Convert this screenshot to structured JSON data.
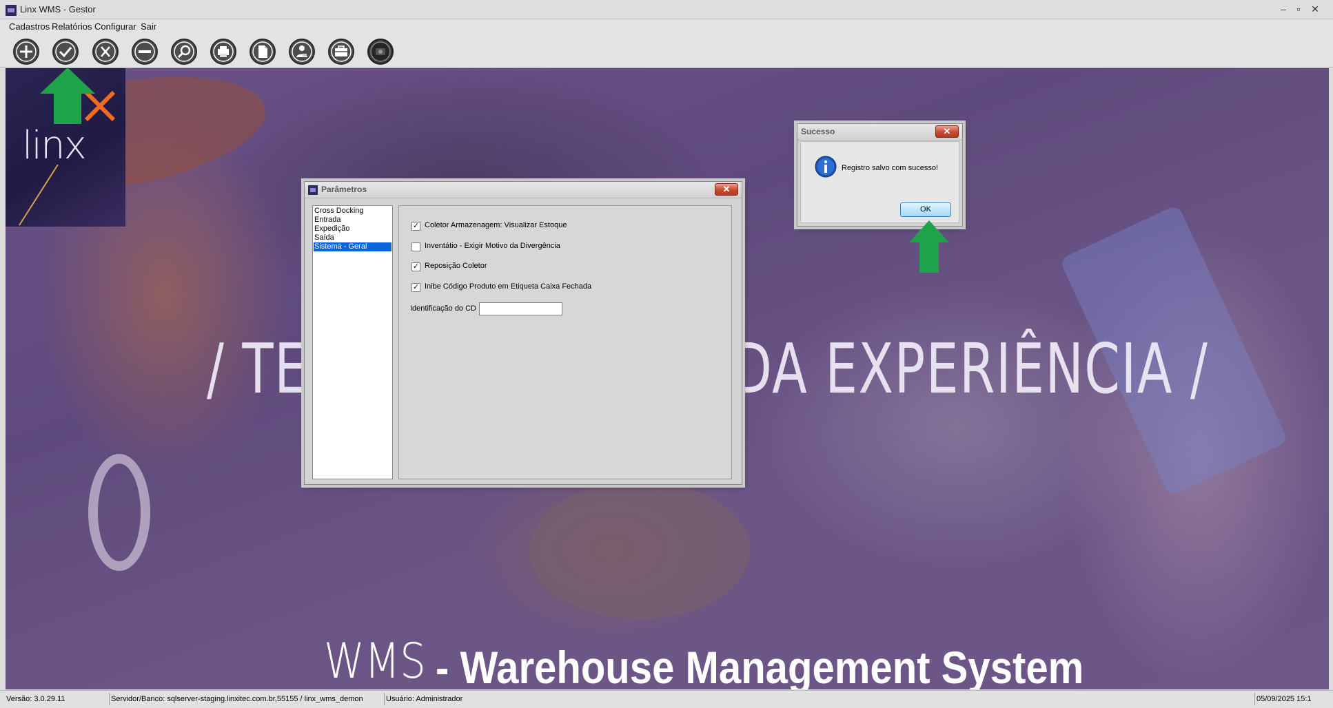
{
  "window": {
    "title": "Linx WMS - Gestor"
  },
  "menu": {
    "items": [
      "Cadastros",
      "Relatórios",
      "Configurar",
      "Sair"
    ]
  },
  "toolbar": {
    "buttons": [
      {
        "icon": "plus-icon"
      },
      {
        "icon": "check-icon"
      },
      {
        "icon": "x-icon"
      },
      {
        "icon": "minus-icon"
      },
      {
        "icon": "search-icon"
      },
      {
        "icon": "printer-icon"
      },
      {
        "icon": "document-icon"
      },
      {
        "icon": "user-icon"
      },
      {
        "icon": "briefcase-icon"
      },
      {
        "icon": "camera-icon"
      }
    ]
  },
  "background": {
    "logo_text": "linx",
    "slogan_left": "/ TE",
    "slogan_right": "DA EXPERIÊNCIA /",
    "wms_logo": "WMS",
    "wms_tagline": "- Warehouse Management System"
  },
  "params_dialog": {
    "title": "Parâmetros",
    "categories": [
      "Cross Docking",
      "Entrada",
      "Expedição",
      "Saída",
      "Sistema - Geral"
    ],
    "selected_category": "Sistema - Geral",
    "options": [
      {
        "label": "Coletor Armazenagem: Visualizar Estoque",
        "checked": true
      },
      {
        "label": "Inventátio - Exigir Motivo da Divergência",
        "checked": false
      },
      {
        "label": "Reposição Coletor",
        "checked": true
      },
      {
        "label": "Inibe Código Produto em Etiqueta Caixa Fechada",
        "checked": true
      }
    ],
    "cd_label": "Identificação do CD",
    "cd_value": ""
  },
  "success_dialog": {
    "title": "Sucesso",
    "message": "Registro salvo com sucesso!",
    "ok_label": "OK"
  },
  "status": {
    "version": "Versão: 3.0.29.11",
    "server": "Servidor/Banco: sqlserver-staging.linxitec.com.br,55155 / linx_wms_demon",
    "user": "Usuário: Administrador",
    "datetime": "05/09/2025 15:1"
  },
  "colors": {
    "guide_arrow": "#1fa34a",
    "selection": "#0a64dc",
    "background_purple": "#6a5186"
  }
}
